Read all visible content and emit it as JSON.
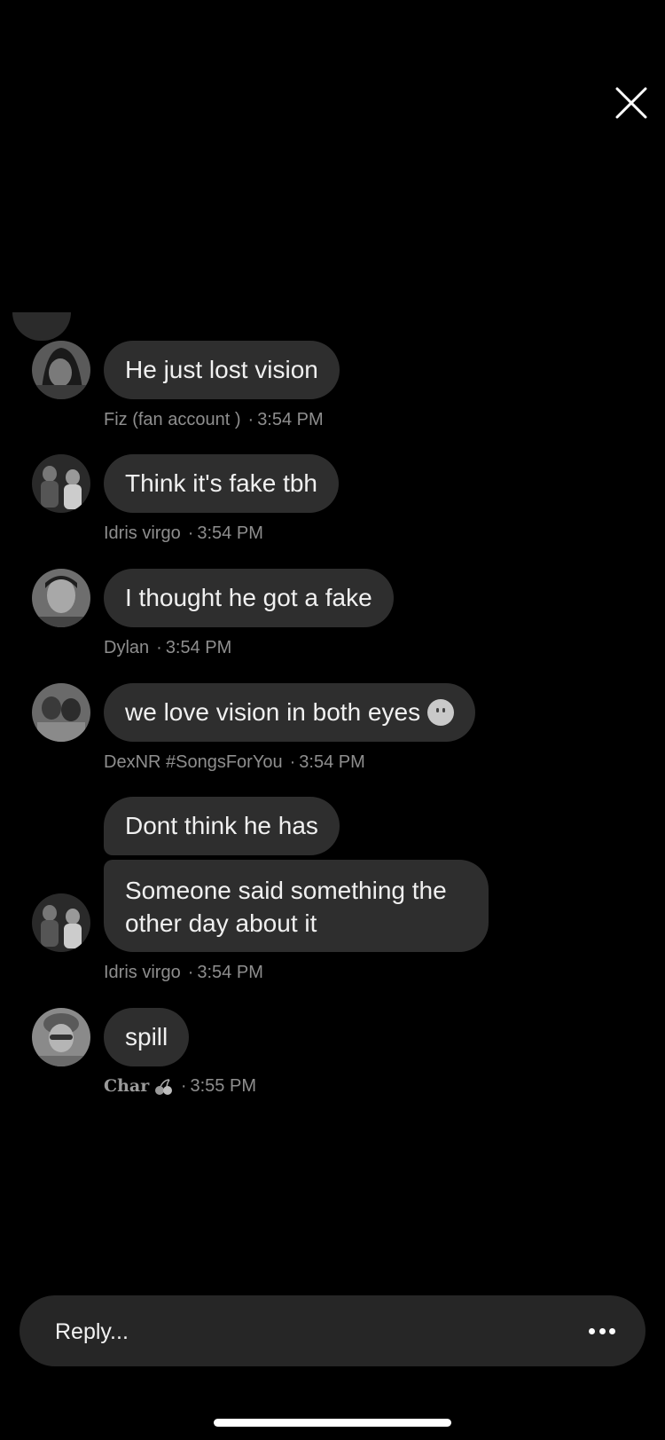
{
  "header": {
    "close_icon": "close-icon"
  },
  "messages": [
    {
      "author": "Fiz (fan account )",
      "time": "3:54 PM",
      "text": "He just lost vision",
      "avatar": "avatar-fiz"
    },
    {
      "author": "Idris virgo",
      "time": "3:54 PM",
      "text": "Think it's fake tbh",
      "avatar": "avatar-idris"
    },
    {
      "author": "Dylan",
      "time": "3:54 PM",
      "text": "I thought he got a fake",
      "avatar": "avatar-dylan"
    },
    {
      "author": "DexNR #SongsForYou",
      "time": "3:54 PM",
      "text": "we love vision in both eyes",
      "emoji": "slightly-smiling-face",
      "avatar": "avatar-dexnr"
    },
    {
      "author": "Idris virgo",
      "time": "3:54 PM",
      "text": "Dont think he has",
      "avatar": "avatar-idris"
    },
    {
      "author": "Idris virgo",
      "time": "3:54 PM",
      "text": "Someone said something the other day about it",
      "avatar": "avatar-idris"
    },
    {
      "author": "Char",
      "author_emoji": "cherries",
      "time": "3:55 PM",
      "text": "spill",
      "avatar": "avatar-char"
    }
  ],
  "separator": "·",
  "reply": {
    "placeholder": "Reply...",
    "more_icon": "more-icon"
  },
  "colors": {
    "background": "#000000",
    "bubble": "#2e2e2e",
    "meta": "#8e8e8e",
    "reply_bar": "#262626"
  }
}
